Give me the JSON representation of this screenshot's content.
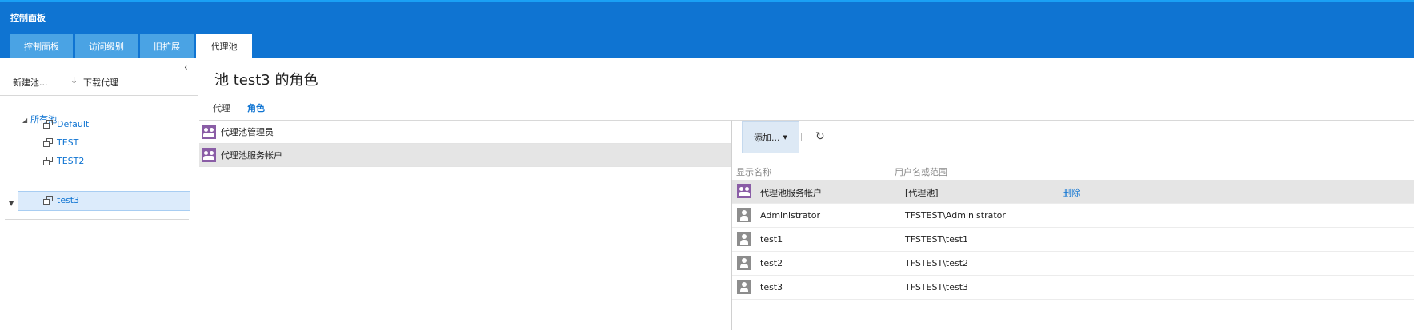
{
  "app": {
    "title": "控制面板"
  },
  "tabs": [
    {
      "label": "控制面板"
    },
    {
      "label": "访问级别"
    },
    {
      "label": "旧扩展"
    },
    {
      "label": "代理池"
    }
  ],
  "left_panel": {
    "collapse_icon": "chevron-left-icon",
    "new_pool_label": "新建池...",
    "download_label": "下载代理",
    "tree": {
      "root_label": "所有池",
      "items": [
        {
          "label": "Default"
        },
        {
          "label": "TEST"
        },
        {
          "label": "TEST2"
        },
        {
          "label": "test3"
        }
      ],
      "selected": "test3"
    }
  },
  "main": {
    "title": "池 test3 的角色",
    "subtabs": [
      {
        "label": "代理"
      },
      {
        "label": "角色"
      }
    ],
    "active_subtab": "角色",
    "roles": [
      {
        "label": "代理池管理员"
      },
      {
        "label": "代理池服务帐户"
      }
    ],
    "selected_role": "代理池服务帐户"
  },
  "members": {
    "add_label": "添加...",
    "refresh_icon": "refresh-icon",
    "columns": {
      "display_name": "显示名称",
      "username": "用户名或范围"
    },
    "rows": [
      {
        "name": "代理池服务帐户",
        "username": "[代理池]",
        "action": "删除",
        "icon": "group-icon"
      },
      {
        "name": "Administrator",
        "username": "TFSTEST\\Administrator",
        "icon": "user-icon"
      },
      {
        "name": "test1",
        "username": "TFSTEST\\test1",
        "icon": "user-icon"
      },
      {
        "name": "test2",
        "username": "TFSTEST\\test2",
        "icon": "user-icon"
      },
      {
        "name": "test3",
        "username": "TFSTEST\\test3",
        "icon": "user-icon"
      }
    ]
  },
  "colors": {
    "header": "#0f74d2",
    "tab_inactive": "#4aa3e4",
    "link": "#0f74d2",
    "group_icon": "#8a5da6",
    "user_icon": "#8d8d8d",
    "selected_row": "#e5e5e5",
    "tree_selected": "#dcebfb"
  }
}
